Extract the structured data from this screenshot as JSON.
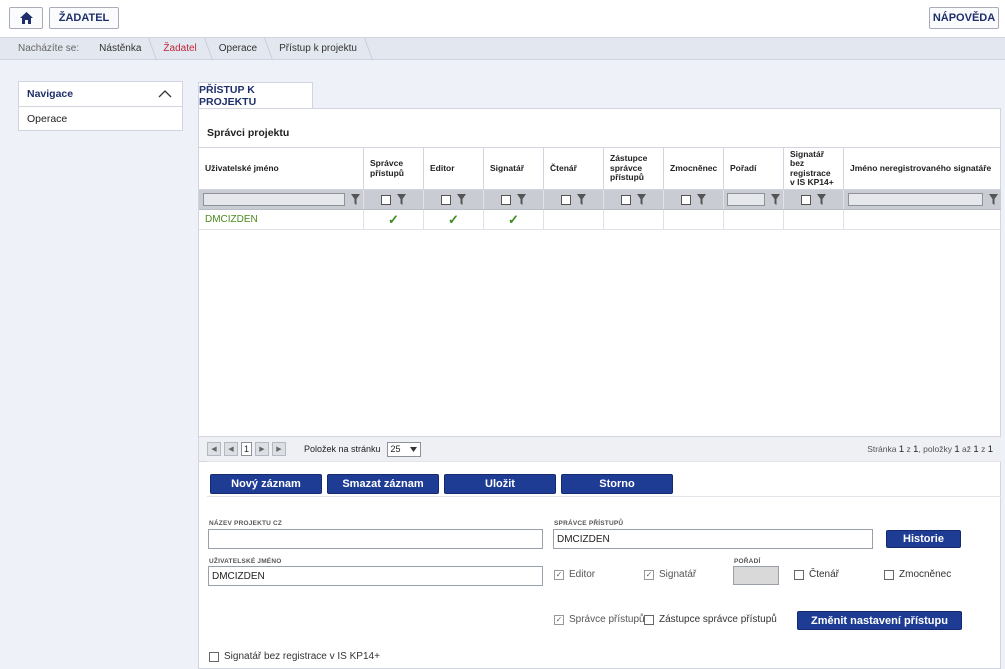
{
  "header": {
    "home_icon": "home-icon",
    "role_label": "ŽADATEL",
    "help_label": "NÁPOVĚDA"
  },
  "breadcrumb": {
    "lead": "Nacházíte se:",
    "items": [
      "Nástěnka",
      "Žadatel",
      "Operace",
      "Přístup k projektu"
    ]
  },
  "sidebar": {
    "title": "Navigace",
    "items": [
      "Operace"
    ]
  },
  "tab": {
    "label": "PŘÍSTUP K PROJEKTU"
  },
  "grid": {
    "title": "Správci projektu",
    "columns": [
      "Uživatelské jméno",
      "Správce přístupů",
      "Editor",
      "Signatář",
      "Čtenář",
      "Zástupce správce přístupů",
      "Zmocněnec",
      "Pořadí",
      "Signatář bez registrace v IS KP14+",
      "Jméno neregistrovaného signatáře"
    ],
    "rows": [
      {
        "name": "DMCIZDEN",
        "spravce": "✓",
        "editor": "✓",
        "signatar": "✓",
        "ctenar": "",
        "zastupce": "",
        "zmocnenec": "",
        "poradi": "",
        "bez_registrace": "",
        "jmeno_nereg": ""
      }
    ],
    "check_color": "#3a8a1e"
  },
  "pager": {
    "current_page": "1",
    "per_page_label": "Položek na stránku",
    "per_page_value": "25",
    "info_prefix": "Stránka",
    "info_page": "1",
    "info_of": "z",
    "info_pages": "1",
    "info_items_label": ", položky",
    "info_from": "1",
    "info_to_label": "až",
    "info_to": "1",
    "info_total": "1"
  },
  "actions": {
    "new": "Nový záznam",
    "delete": "Smazat záznam",
    "save": "Uložit",
    "cancel": "Storno"
  },
  "form": {
    "project_name_label": "NÁZEV PROJEKTU CZ",
    "project_name_value": "",
    "access_admin_label": "SPRÁVCE PŘÍSTUPŮ",
    "access_admin_value": "DMCIZDEN",
    "history_button": "Historie",
    "username_label": "UŽIVATELSKÉ JMÉNO",
    "username_value": "DMCIZDEN",
    "editor_label": "Editor",
    "signatar_label": "Signatář",
    "order_label": "POŘADÍ",
    "reader_label": "Čtenář",
    "proxy_label": "Zmocněnec",
    "access_admin_chk_label": "Správce přístupů",
    "deputy_label": "Zástupce správce přístupů",
    "change_access_button": "Změnit nastavení přístupu",
    "unregistered_signer_label": "Signatář bez registrace v IS KP14+"
  },
  "colors": {
    "accent": "#1f3c95",
    "title_text": "#1e2f6b",
    "active_breadcrumb": "#c0283a"
  }
}
